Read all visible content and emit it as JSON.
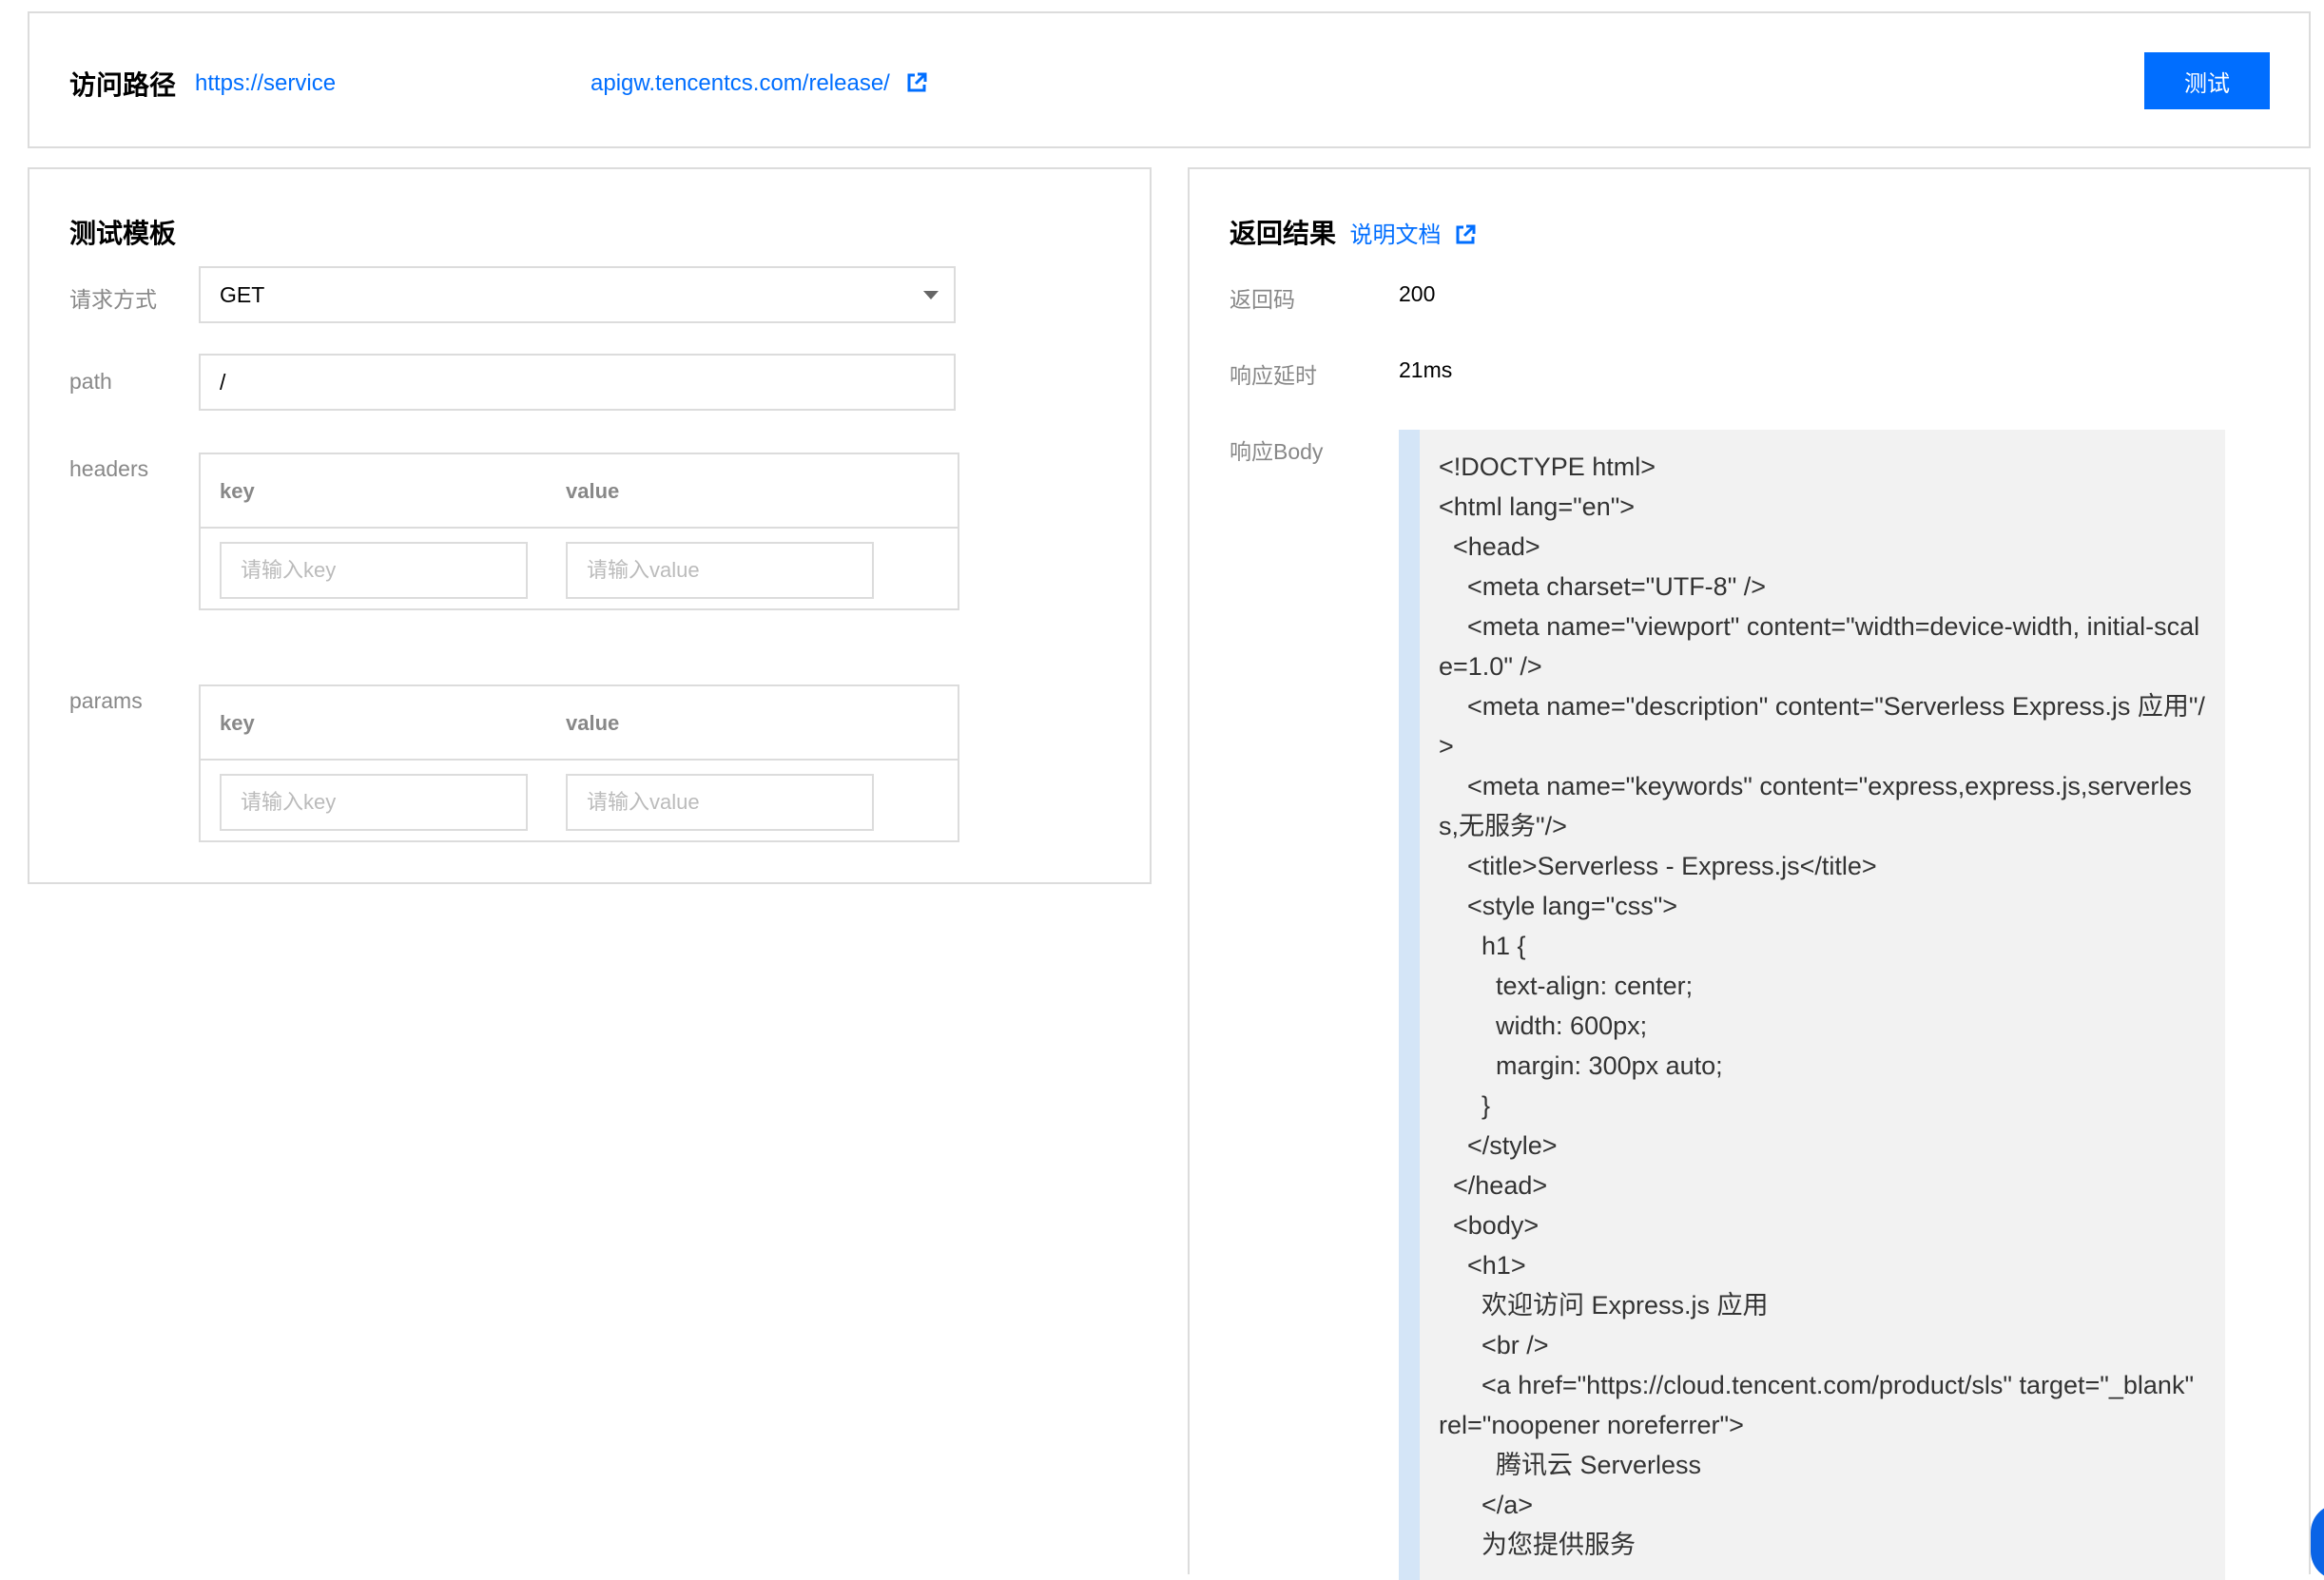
{
  "access": {
    "label": "访问路径",
    "url_start": "https://service",
    "url_end": "apigw.tencentcs.com/release/",
    "test_button": "测试"
  },
  "template": {
    "title": "测试模板",
    "method_label": "请求方式",
    "method_value": "GET",
    "path_label": "path",
    "path_value": "/",
    "headers_label": "headers",
    "params_label": "params",
    "key_header": "key",
    "value_header": "value",
    "key_placeholder": "请输入key",
    "value_placeholder": "请输入value"
  },
  "result": {
    "title": "返回结果",
    "doc_link": "说明文档",
    "code_label": "返回码",
    "code_value": "200",
    "latency_label": "响应延时",
    "latency_value": "21ms",
    "body_label": "响应Body",
    "body_lines": [
      "<!DOCTYPE html>",
      "<html lang=\"en\">",
      "  <head>",
      "    <meta charset=\"UTF-8\" />",
      "    <meta name=\"viewport\" content=\"width=device-width, initial-scale=1.0\" />",
      "    <meta name=\"description\" content=\"Serverless Express.js 应用\"/>",
      "    <meta name=\"keywords\" content=\"express,express.js,serverless,无服务\"/>",
      "    <title>Serverless - Express.js</title>",
      "    <style lang=\"css\">",
      "      h1 {",
      "        text-align: center;",
      "        width: 600px;",
      "        margin: 300px auto;",
      "      }",
      "    </style>",
      "  </head>",
      "  <body>",
      "    <h1>",
      "      欢迎访问 Express.js 应用",
      "      <br />",
      "      <a href=\"https://cloud.tencent.com/product/sls\" target=\"_blank\" rel=\"noopener noreferrer\">",
      "        腾讯云 Serverless",
      "      </a>",
      "      为您提供服务"
    ]
  },
  "colors": {
    "accent": "#006eff",
    "border": "#dcdcdc",
    "code_bg": "#f2f2f2",
    "code_bar": "#d4e5f7"
  }
}
